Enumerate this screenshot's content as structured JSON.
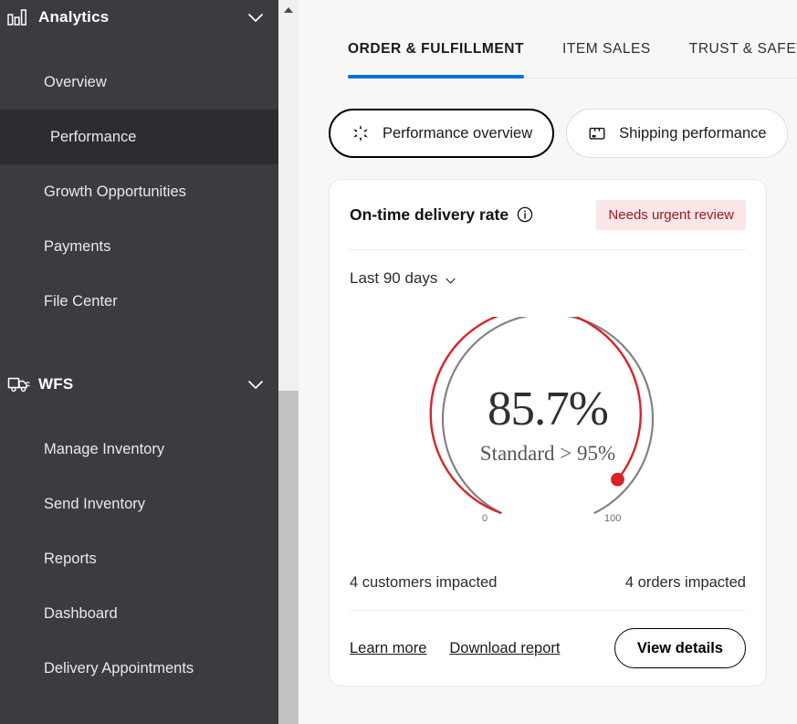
{
  "sidebar": {
    "groups": [
      {
        "label": "Analytics",
        "icon": "bar-chart-icon",
        "expanded_icon": "chevron-down-icon",
        "items": [
          {
            "label": "Overview",
            "active": false
          },
          {
            "label": "Performance",
            "active": true
          },
          {
            "label": "Growth Opportunities",
            "active": false
          },
          {
            "label": "Payments",
            "active": false
          },
          {
            "label": "File Center",
            "active": false
          }
        ]
      },
      {
        "label": "WFS",
        "icon": "truck-icon",
        "expanded_icon": "chevron-down-icon",
        "items": [
          {
            "label": "Manage Inventory",
            "active": false
          },
          {
            "label": "Send Inventory",
            "active": false
          },
          {
            "label": "Reports",
            "active": false
          },
          {
            "label": "Dashboard",
            "active": false
          },
          {
            "label": "Delivery Appointments",
            "active": false
          }
        ]
      }
    ],
    "scrollbar": {
      "up_arrow_icon": "triangle-up-icon"
    }
  },
  "main": {
    "tabs": [
      {
        "label": "ORDER & FULFILLMENT",
        "active": true
      },
      {
        "label": "ITEM SALES",
        "active": false
      },
      {
        "label": "TRUST & SAFETY",
        "active": false
      }
    ],
    "segments": [
      {
        "label": "Performance overview",
        "icon": "spark-icon",
        "selected": true
      },
      {
        "label": "Shipping performance",
        "icon": "package-box-icon",
        "selected": false
      }
    ],
    "card": {
      "title": "On-time delivery rate",
      "info_icon": "info-icon",
      "badge": "Needs urgent review",
      "period": "Last 90 days",
      "period_chevron": "chevron-down-icon",
      "stats": [
        "4 customers impacted",
        "4 orders impacted"
      ],
      "links": [
        "Learn more",
        "Download report"
      ],
      "primary_button": "View details"
    }
  },
  "chart_data": {
    "type": "gauge",
    "title": "On-time delivery rate",
    "value": 85.7,
    "value_label": "85.7%",
    "target_label": "Standard > 95%",
    "target": 95,
    "min": 0,
    "max": 100,
    "min_tick_label": "0",
    "max_tick_label": "100",
    "period": "Last 90 days",
    "status": "Needs urgent review",
    "value_color": "#d8232a",
    "track_color": "#808285",
    "marker": {
      "value": 85.7,
      "color": "#d8232a",
      "shape": "circle"
    },
    "annotations": [
      "4 customers impacted",
      "4 orders impacted"
    ]
  },
  "colors": {
    "sidebar_bg": "#3b3c40",
    "sidebar_active": "#2c2d30",
    "accent_blue": "#0071dc",
    "alert_red": "#d8232a",
    "badge_bg": "#fbe6e8",
    "badge_text": "#9c1a21",
    "page_bg": "#f7f7f7"
  }
}
